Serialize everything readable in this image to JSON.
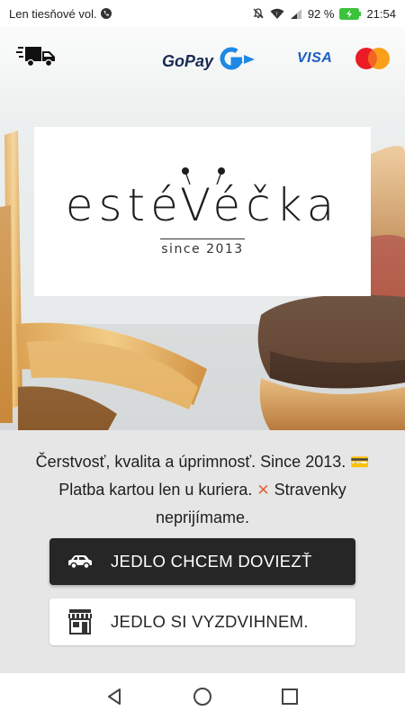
{
  "status_bar": {
    "carrier": "Len tiesňové vol.",
    "battery_percent": "92 %",
    "time": "21:54"
  },
  "payment_icons": {
    "gopay_label": "GoPay",
    "visa_label": "VISA"
  },
  "logo": {
    "wordmark": "estéVéčka",
    "since": "since 2013"
  },
  "tagline": {
    "line1": "Čerstvosť, kvalita a úprimnosť. Since 2013.",
    "line2": "Platba kartou len u kuriera.",
    "line2b": "Stravenky",
    "line3": "neprijímame.",
    "card_emoji": "💳",
    "cross_emoji": "✕"
  },
  "buttons": {
    "delivery_label": "JEDLO CHCEM DOVIEZŤ",
    "pickup_label": "JEDLO SI VYZDVIHNEM."
  },
  "colors": {
    "dark_button": "#262626",
    "sheet_bg": "#e6e6e6",
    "gopay_accent": "#1e88e5",
    "visa_blue": "#1a5fc2"
  },
  "icons": {
    "truck": "delivery-truck-icon",
    "car": "car-icon",
    "store": "store-icon",
    "back": "back-icon",
    "home": "home-icon",
    "recents": "recents-icon"
  }
}
